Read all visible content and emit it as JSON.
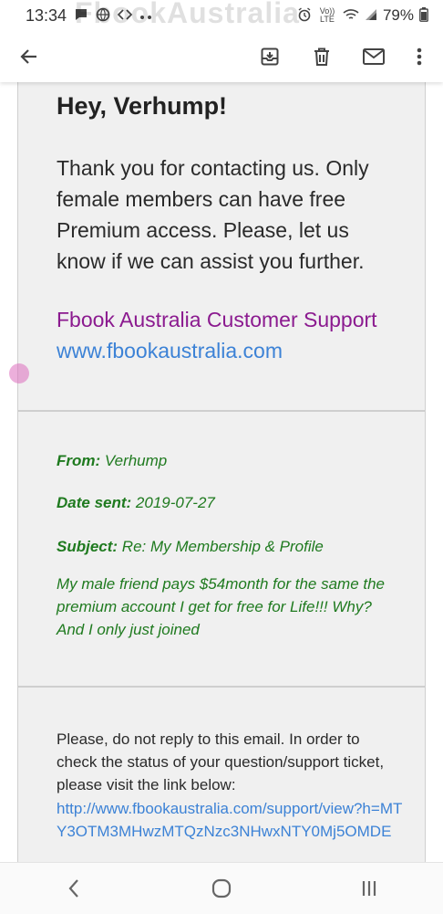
{
  "status_bar": {
    "time": "13:34",
    "battery": "79%",
    "left_icons": [
      "message-icon",
      "globe-icon",
      "code-icon",
      "more-dots-icon"
    ],
    "right_icons": [
      "alarm-icon",
      "volte-icon",
      "wifi-icon",
      "signal-icon",
      "battery-icon"
    ],
    "volte_label": "Vo)) LTE"
  },
  "watermark": "FbookAustralia",
  "toolbar": {
    "icons": [
      "back-arrow-icon",
      "archive-icon",
      "delete-icon",
      "mark-unread-icon",
      "more-vert-icon"
    ]
  },
  "email": {
    "greeting": "Hey, Verhump!",
    "body": "Thank you for contacting us. Only female members can have free Premium access. Please, let us know if we can assist you further.",
    "signature": "Fbook Australia Customer Support",
    "signature_link": "www.fbookaustralia.com",
    "quoted": {
      "from_label": "From:",
      "from_value": "Verhump",
      "date_label": "Date sent:",
      "date_value": "2019-07-27",
      "subject_label": "Subject:",
      "subject_value": "Re: My Membership & Profile",
      "message": "My male friend pays $54month for the same the premium account I get for free for Life!!! Why? And I only just joined"
    },
    "notice": "Please, do not reply to this email. In order to check the status of your question/support ticket, please visit the link below:",
    "ticket_link": "http://www.fbookaustralia.com/support/view?h=MTY3OTM3MHwzMTQzNzc3NHwxNTY0Mj5OMDE"
  },
  "nav_bar": {
    "icons": [
      "nav-back-icon",
      "nav-home-icon",
      "nav-recents-icon"
    ]
  },
  "colors": {
    "panel_bg": "#f0f0f0",
    "quote_green": "#1f7a1f",
    "signature_purple": "#8b1a8f",
    "link_blue": "#3c82d6"
  }
}
